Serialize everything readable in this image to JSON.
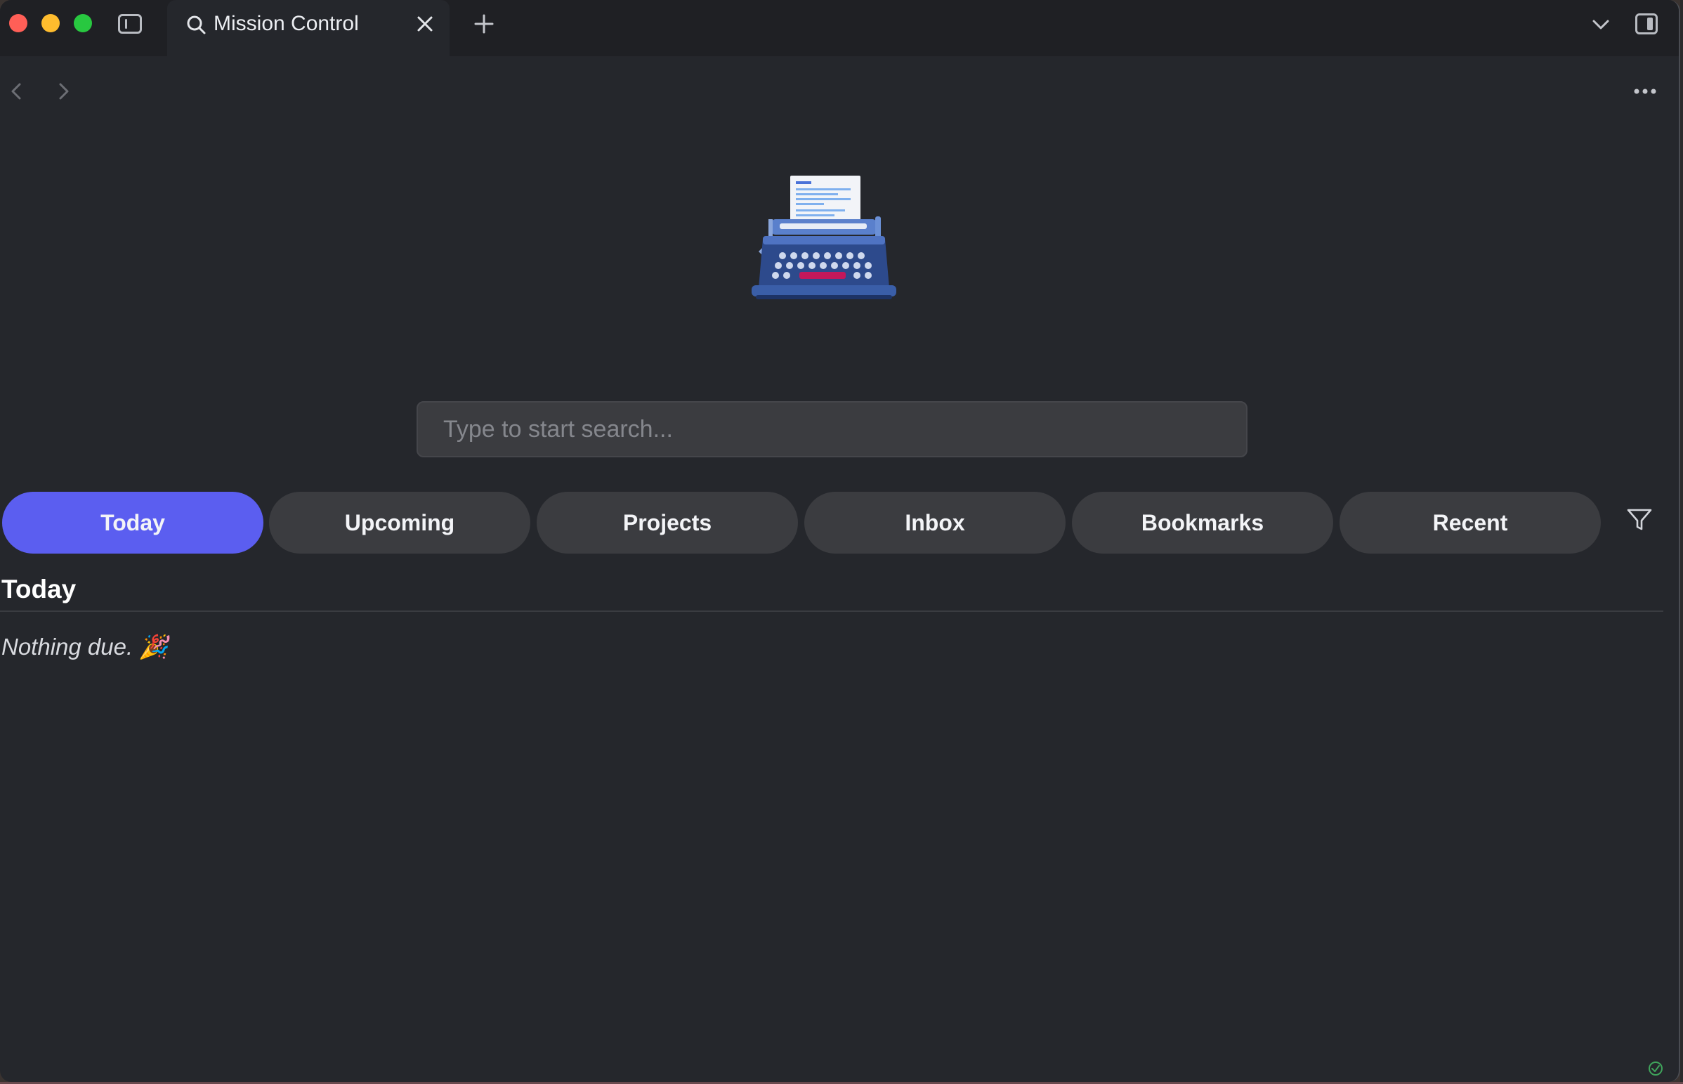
{
  "window": {
    "tab": {
      "title": "Mission Control"
    }
  },
  "search": {
    "placeholder": "Type to start search..."
  },
  "filters": [
    {
      "label": "Today",
      "active": true
    },
    {
      "label": "Upcoming",
      "active": false
    },
    {
      "label": "Projects",
      "active": false
    },
    {
      "label": "Inbox",
      "active": false
    },
    {
      "label": "Bookmarks",
      "active": false
    },
    {
      "label": "Recent",
      "active": false
    }
  ],
  "section": {
    "title": "Today",
    "empty_message": "Nothing due. 🎉"
  },
  "icons": {
    "tab": "search-icon",
    "close": "close-icon",
    "new_tab": "plus-icon",
    "hero": "typewriter-icon",
    "filter": "filter-icon",
    "status": "check-circle-icon"
  },
  "colors": {
    "accent": "#5b5ef0",
    "background": "#25272c",
    "pill": "#3b3c40"
  }
}
